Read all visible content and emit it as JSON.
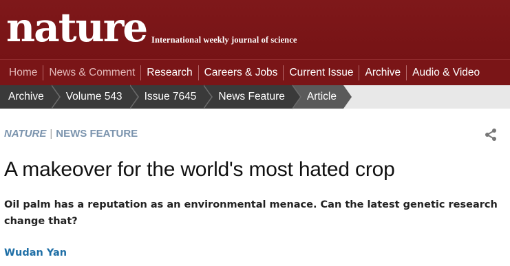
{
  "masthead": {
    "logo": "nature",
    "tagline": "International weekly journal of science"
  },
  "nav": {
    "items": [
      {
        "label": "Home",
        "muted": true
      },
      {
        "label": "News & Comment",
        "muted": true
      },
      {
        "label": "Research",
        "muted": false
      },
      {
        "label": "Careers & Jobs",
        "muted": false
      },
      {
        "label": "Current Issue",
        "muted": false
      },
      {
        "label": "Archive",
        "muted": false
      },
      {
        "label": "Audio & Video",
        "muted": false
      }
    ]
  },
  "breadcrumb": {
    "items": [
      "Archive",
      "Volume 543",
      "Issue 7645",
      "News Feature",
      "Article"
    ]
  },
  "article": {
    "journal": "NATURE",
    "separator": "|",
    "section": "NEWS FEATURE",
    "title": "A makeover for the world's most hated crop",
    "standfirst": "Oil palm has a reputation as an environmental menace. Can the latest genetic research change that?",
    "author": "Wudan Yan"
  },
  "icons": {
    "share": "share-icon"
  },
  "colors": {
    "masthead": "#7a1517",
    "breadcrumb_bg": "#3a3a3a",
    "section_label": "#7a93ad",
    "author_link": "#1f6fa6"
  }
}
